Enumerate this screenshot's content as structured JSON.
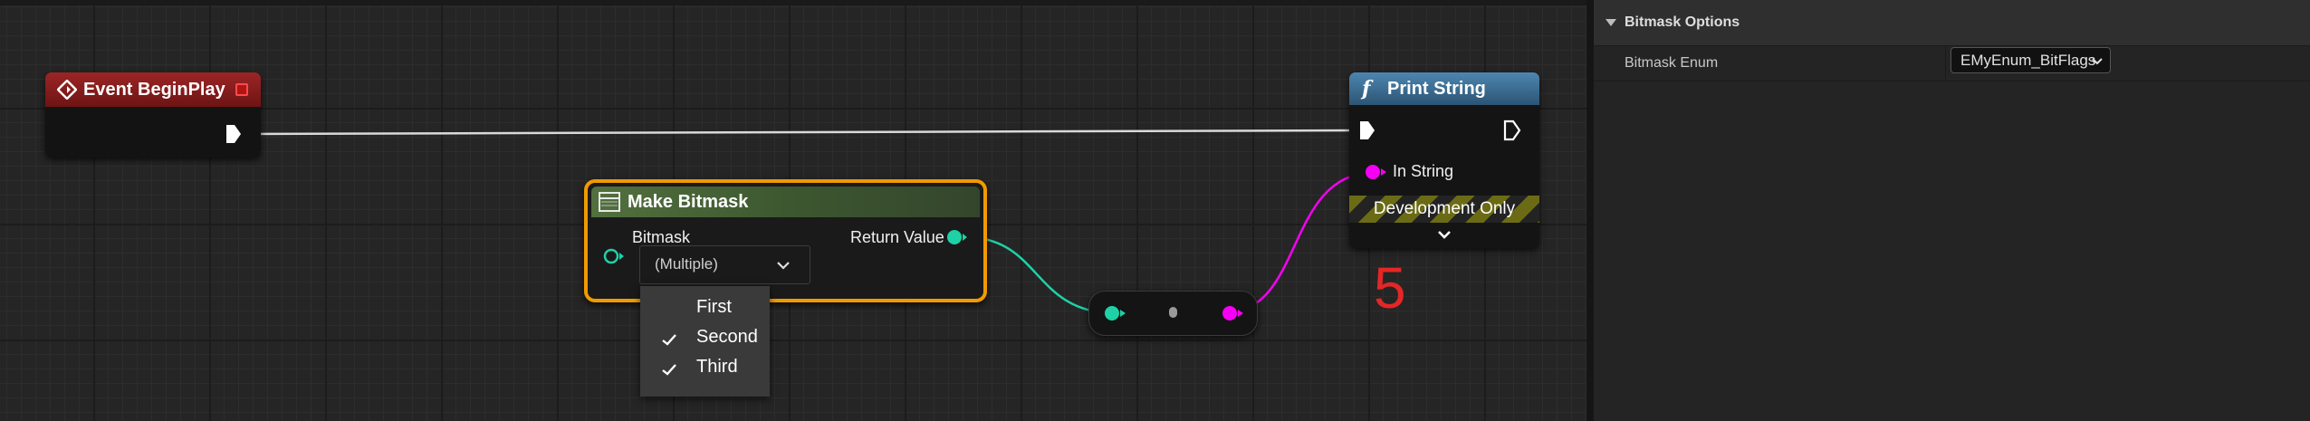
{
  "graph": {
    "nodes": {
      "event_begin_play": {
        "title": "Event BeginPlay"
      },
      "make_bitmask": {
        "title": "Make Bitmask",
        "input_label": "Bitmask",
        "output_label": "Return Value",
        "combo_value": "(Multiple)"
      },
      "print_string": {
        "title": "Print String",
        "function_glyph": "f",
        "in_string_label": "In String",
        "dev_only_label": "Development Only"
      }
    },
    "bitmask_dropdown": {
      "items": [
        {
          "label": "First",
          "checked": false
        },
        {
          "label": "Second",
          "checked": true
        },
        {
          "label": "Third",
          "checked": true
        }
      ]
    },
    "annotation": "5"
  },
  "details_panel": {
    "category_title": "Bitmask Options",
    "row_label": "Bitmask Enum",
    "row_value": "EMyEnum_BitFlags"
  },
  "colors": {
    "event_header": "#8a1c1c",
    "function_header": "#3a6b90",
    "make_bitmask_header": "#4a6a3a",
    "selection_outline": "#f09a00",
    "integer_pin": "#1fd1a6",
    "string_pin": "#f500f5",
    "annotation_text": "#e52626"
  }
}
